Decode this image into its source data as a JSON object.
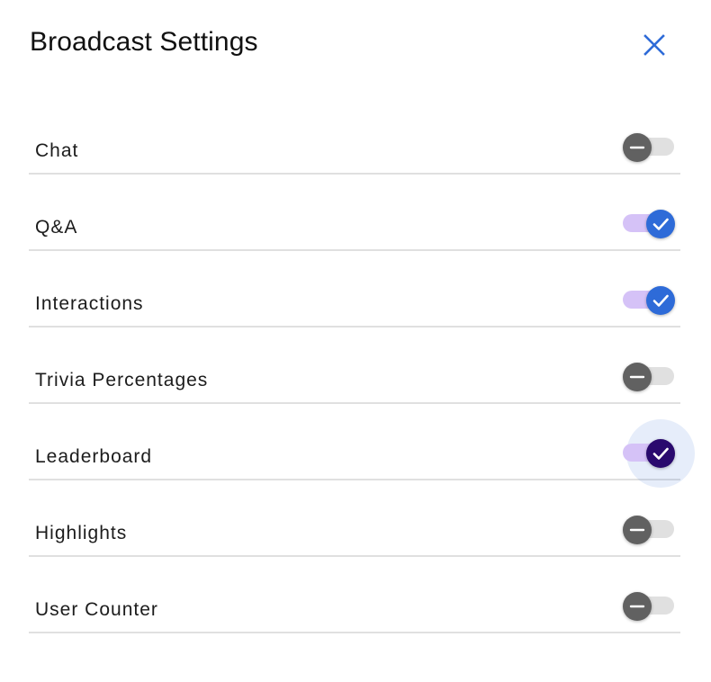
{
  "dialog": {
    "title": "Broadcast Settings",
    "close_icon": "close-icon",
    "accent_color": "#2e6bd8",
    "focused_thumb_color": "#2a0a6e",
    "track_on_color": "#d5c2f7",
    "thumb_off_color": "#616161"
  },
  "settings": [
    {
      "label": "Chat",
      "enabled": false,
      "icon": "minus-icon"
    },
    {
      "label": "Q&A",
      "enabled": true,
      "icon": "check-icon"
    },
    {
      "label": "Interactions",
      "enabled": true,
      "icon": "check-icon"
    },
    {
      "label": "Trivia Percentages",
      "enabled": false,
      "icon": "minus-icon"
    },
    {
      "label": "Leaderboard",
      "enabled": true,
      "focused": true,
      "icon": "check-icon"
    },
    {
      "label": "Highlights",
      "enabled": false,
      "icon": "minus-icon"
    },
    {
      "label": "User Counter",
      "enabled": false,
      "icon": "minus-icon"
    }
  ]
}
